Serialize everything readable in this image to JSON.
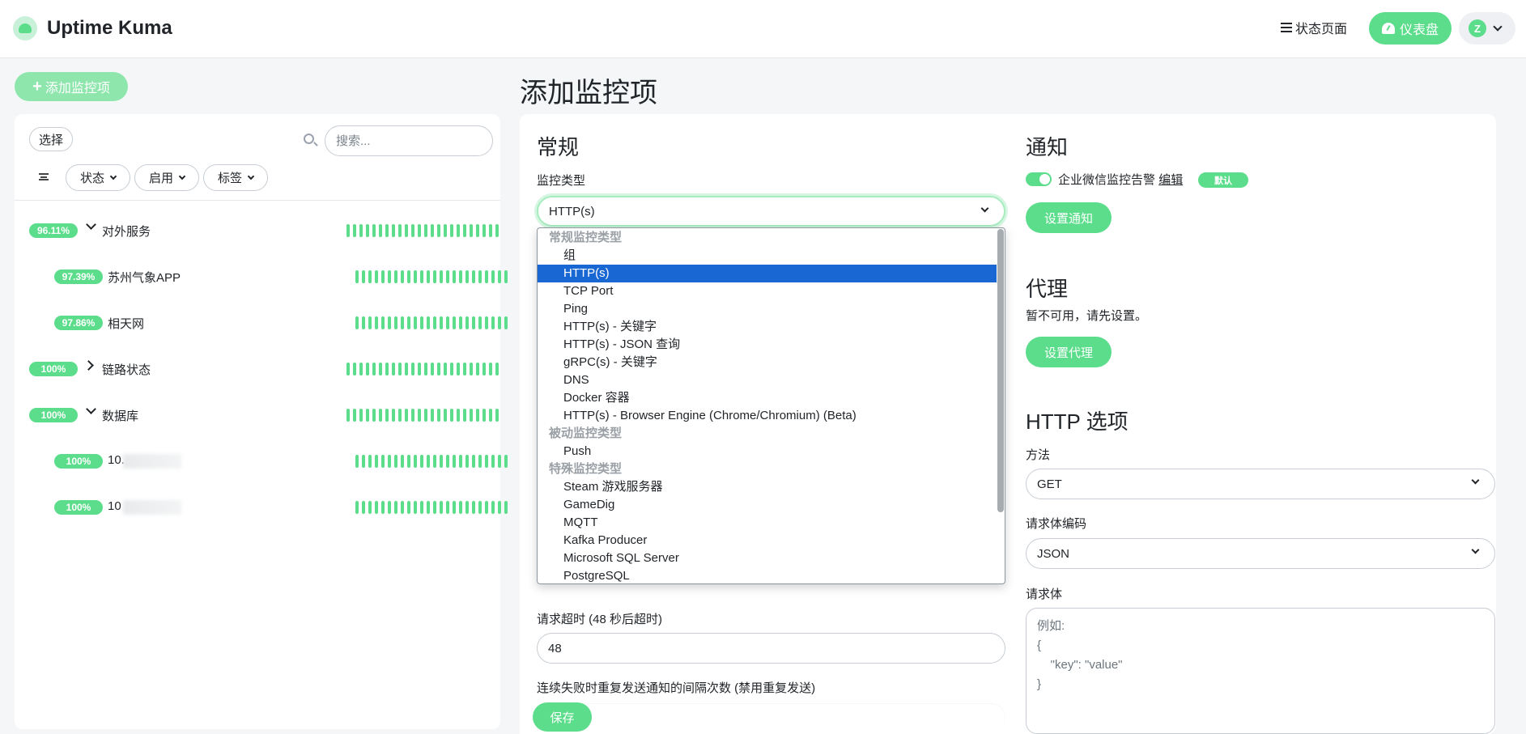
{
  "app": {
    "title": "Uptime Kuma"
  },
  "nav": {
    "status_page": "状态页面",
    "dashboard": "仪表盘",
    "profile_initial": "Z"
  },
  "sidebar": {
    "add_button": "添加监控项",
    "select_button": "选择",
    "search_placeholder": "搜索...",
    "filters": [
      "状态",
      "启用",
      "标签"
    ],
    "monitors": [
      {
        "uptime": "96.11%",
        "name": "对外服务",
        "type": "group",
        "expanded": true,
        "level": 0
      },
      {
        "uptime": "97.39%",
        "name": "苏州气象APP",
        "type": "monitor",
        "level": 1
      },
      {
        "uptime": "97.86%",
        "name": "相天网",
        "type": "monitor",
        "level": 1
      },
      {
        "uptime": "100%",
        "name": "链路状态",
        "type": "group",
        "expanded": false,
        "level": 0
      },
      {
        "uptime": "100%",
        "name": "数据库",
        "type": "group",
        "expanded": true,
        "level": 0
      },
      {
        "uptime": "100%",
        "name": "10.",
        "type": "monitor",
        "level": 1
      },
      {
        "uptime": "100%",
        "name": "10",
        "type": "monitor",
        "level": 1
      }
    ],
    "heartbeat_color": "#5cdd8b"
  },
  "page": {
    "title": "添加监控项"
  },
  "general": {
    "title": "常规",
    "monitor_type_label": "监控类型",
    "monitor_type_value": "HTTP(s)",
    "timeout_label": "请求超时 (48 秒后超时)",
    "timeout_value": "48",
    "resend_label": "连续失败时重复发送通知的间隔次数 (禁用重复发送)",
    "save_button": "保存"
  },
  "dropdown": {
    "groups": [
      {
        "label": "常规监控类型",
        "options": [
          "组",
          "HTTP(s)",
          "TCP Port",
          "Ping",
          "HTTP(s) - 关键字",
          "HTTP(s) - JSON 查询",
          "gRPC(s) - 关键字",
          "DNS",
          "Docker 容器",
          "HTTP(s) - Browser Engine (Chrome/Chromium) (Beta)"
        ]
      },
      {
        "label": "被动监控类型",
        "options": [
          "Push"
        ]
      },
      {
        "label": "特殊监控类型",
        "options": [
          "Steam 游戏服务器",
          "GameDig",
          "MQTT",
          "Kafka Producer",
          "Microsoft SQL Server",
          "PostgreSQL"
        ]
      }
    ],
    "selected": "HTTP(s)",
    "highlight_color": "#1967d2"
  },
  "notifications": {
    "title": "通知",
    "item_name": "企业微信监控告警",
    "edit_link": "编辑",
    "default_badge": "默认",
    "setup_button": "设置通知"
  },
  "proxy": {
    "title": "代理",
    "unavailable_text": "暂不可用，请先设置。",
    "setup_button": "设置代理"
  },
  "http_options": {
    "title": "HTTP 选项",
    "method_label": "方法",
    "method_value": "GET",
    "body_encoding_label": "请求体编码",
    "body_encoding_value": "JSON",
    "body_label": "请求体",
    "body_placeholder": "例如:\n{\n    \"key\": \"value\"\n}"
  },
  "colors": {
    "accent": "#5cdd8b",
    "accent_light": "#8ee6ad"
  }
}
